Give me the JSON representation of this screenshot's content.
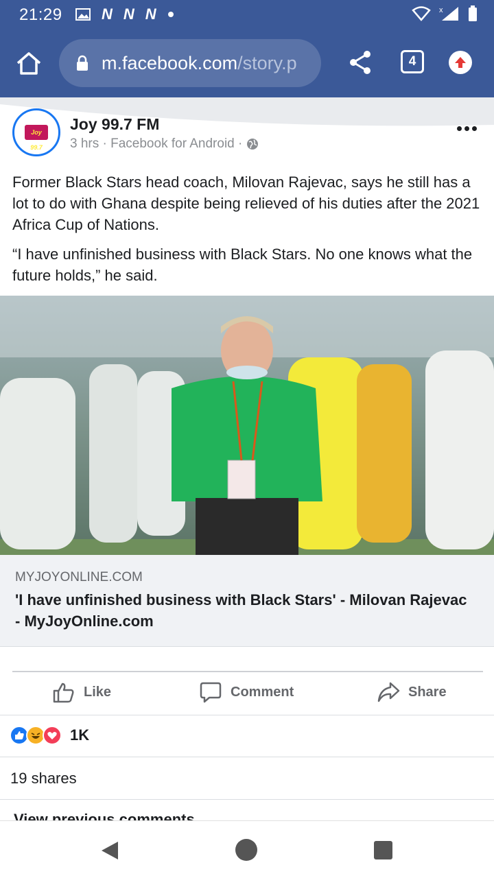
{
  "status_bar": {
    "time": "21:29",
    "notifications": [
      "N",
      "N",
      "N"
    ],
    "notification_icons": [
      "image-icon",
      "n-icon",
      "n-icon",
      "n-icon",
      "dot-icon"
    ],
    "right_icons": [
      "wifi-icon",
      "signal-icon",
      "battery-icon"
    ]
  },
  "browser": {
    "url_host": "m.facebook.com",
    "url_path": "/story.p",
    "tab_count": "4",
    "icons": [
      "home-icon",
      "lock-icon",
      "share-icon",
      "tabs-icon",
      "update-icon"
    ]
  },
  "post": {
    "page_name": "Joy 99.7 FM",
    "avatar_text": "Joy 99.7",
    "meta": "3 hrs · Facebook for Android ·",
    "paragraphs": [
      "Former Black Stars head coach, Milovan Rajevac, says he still has a lot to do with Ghana despite being relieved of his duties after the 2021 Africa Cup of Nations.",
      "“I have unfinished business with Black Stars. No one knows what the future holds,” he said."
    ],
    "link_domain": "MYJOYONLINE.COM",
    "link_title": "'I have unfinished business with Black Stars' - Milovan Rajevac - MyJoyOnline.com"
  },
  "actions": {
    "like": "Like",
    "comment": "Comment",
    "share": "Share"
  },
  "engagement": {
    "reaction_count": "1K",
    "shares": "19 shares",
    "view_previous": "View previous comments"
  },
  "colors": {
    "brand": "#3b5998",
    "like_blue": "#1877f2",
    "love_red": "#f33e58",
    "haha_yellow": "#f7b125"
  }
}
